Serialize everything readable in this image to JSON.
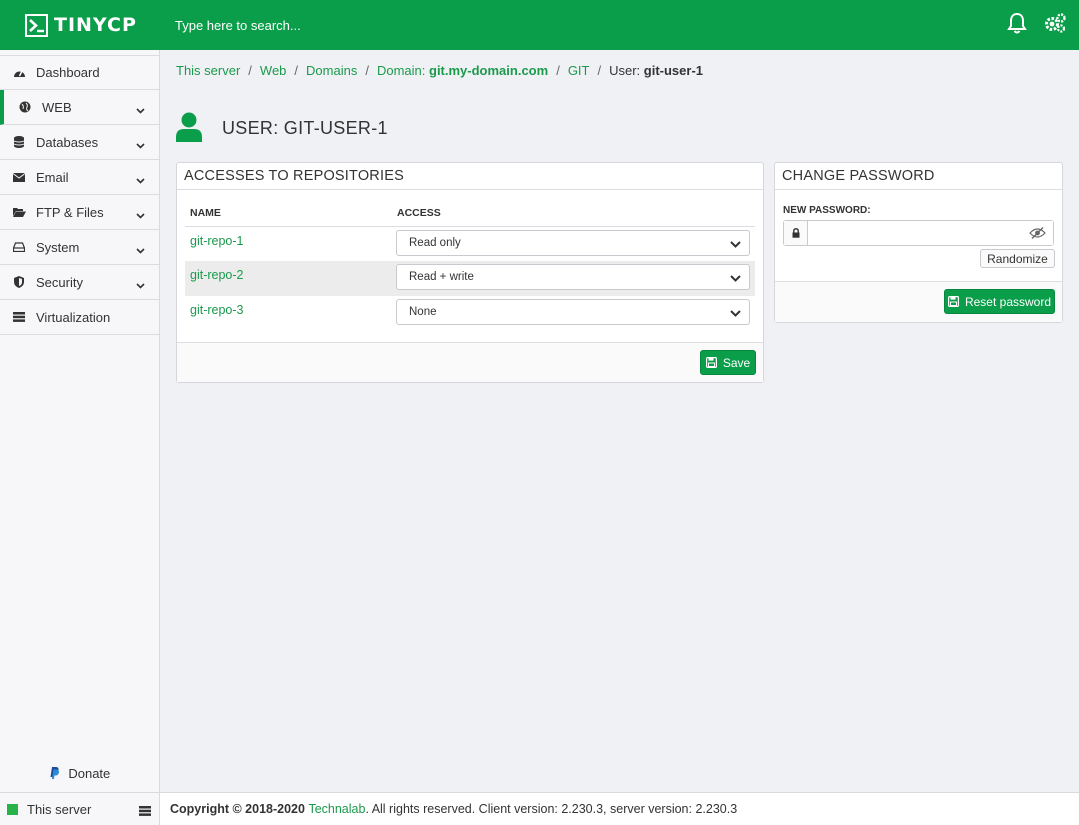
{
  "brand": {
    "name": "TINYCP",
    "accent": "#0a9e4a"
  },
  "search": {
    "placeholder": "Type here to search..."
  },
  "top_icons": [
    "bell-icon",
    "gears-icon"
  ],
  "sidebar": {
    "items": [
      {
        "label": "Dashboard",
        "icon": "dashboard-icon",
        "has_chevron": false
      },
      {
        "label": "WEB",
        "icon": "globe-icon",
        "has_chevron": true,
        "active": true
      },
      {
        "label": "Databases",
        "icon": "database-icon",
        "has_chevron": true
      },
      {
        "label": "Email",
        "icon": "envelope-icon",
        "has_chevron": true
      },
      {
        "label": "FTP & Files",
        "icon": "folder-icon",
        "has_chevron": true
      },
      {
        "label": "System",
        "icon": "hdd-icon",
        "has_chevron": true
      },
      {
        "label": "Security",
        "icon": "shield-icon",
        "has_chevron": true
      },
      {
        "label": "Virtualization",
        "icon": "server-icon",
        "has_chevron": false
      }
    ],
    "donate": "Donate"
  },
  "breadcrumb": {
    "items": [
      "This server",
      "Web",
      "Domains"
    ],
    "domain_prefix": "Domain: ",
    "domain_name": "git.my-domain.com",
    "git": "GIT",
    "current_prefix": "User: ",
    "current_name": "git-user-1"
  },
  "page": {
    "title": "USER: GIT-USER-1"
  },
  "access_panel": {
    "title": "ACCESSES TO REPOSITORIES",
    "columns": [
      "NAME",
      "ACCESS"
    ],
    "rows": [
      {
        "name": "git-repo-1",
        "access": "Read only"
      },
      {
        "name": "git-repo-2",
        "access": "Read + write"
      },
      {
        "name": "git-repo-3",
        "access": "None"
      }
    ],
    "save_label": "Save"
  },
  "password_panel": {
    "title": "CHANGE PASSWORD",
    "new_password_label": "NEW PASSWORD:",
    "new_password_value": "",
    "randomize_label": "Randomize",
    "reset_label": "Reset password"
  },
  "footer": {
    "server_label": "This server",
    "copyright_prefix": "Copyright © 2018-2020 ",
    "company": "Technalab",
    "rest": ". All rights reserved. Client version: 2.230.3, server version: 2.230.3"
  }
}
